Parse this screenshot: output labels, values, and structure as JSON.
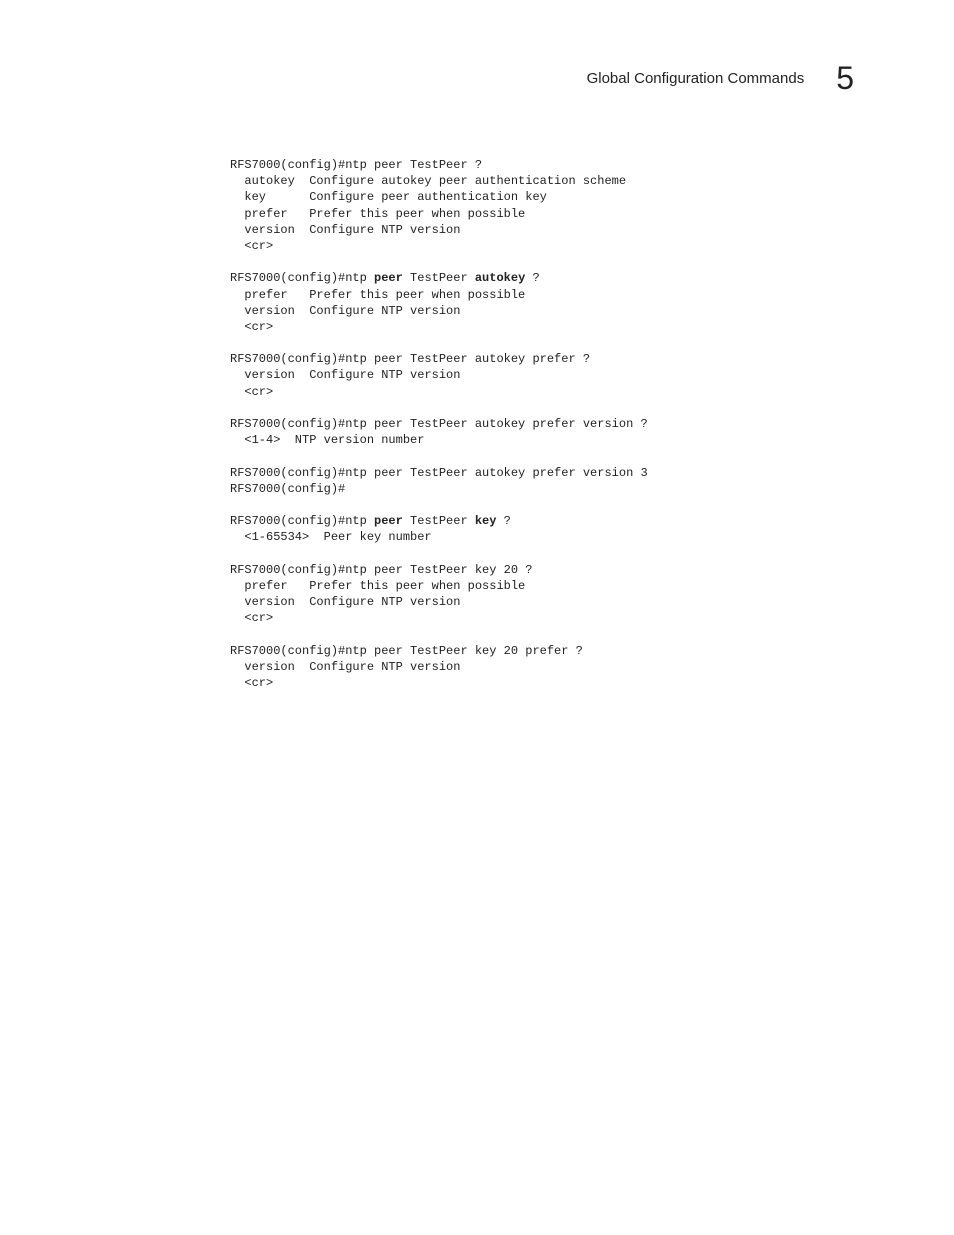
{
  "header": {
    "title": "Global Configuration Commands",
    "chapter": "5"
  },
  "code": {
    "l01a": "RFS7000(config)#ntp peer TestPeer ?",
    "l01b": "  autokey  Configure autokey peer authentication scheme",
    "l01c": "  key      Configure peer authentication key",
    "l01d": "  prefer   Prefer this peer when possible",
    "l01e": "  version  Configure NTP version",
    "l01f": "  <cr>",
    "l02a_pre": "RFS7000(config)#ntp ",
    "l02a_b1": "peer",
    "l02a_mid": " TestPeer ",
    "l02a_b2": "autokey",
    "l02a_post": " ?",
    "l02b": "  prefer   Prefer this peer when possible",
    "l02c": "  version  Configure NTP version",
    "l02d": "  <cr>",
    "l03a": "RFS7000(config)#ntp peer TestPeer autokey prefer ?",
    "l03b": "  version  Configure NTP version",
    "l03c": "  <cr>",
    "l04a": "RFS7000(config)#ntp peer TestPeer autokey prefer version ?",
    "l04b": "  <1-4>  NTP version number",
    "l05a": "RFS7000(config)#ntp peer TestPeer autokey prefer version 3",
    "l05b": "RFS7000(config)#",
    "l06a_pre": "RFS7000(config)#ntp ",
    "l06a_b1": "peer",
    "l06a_mid": " TestPeer ",
    "l06a_b2": "key",
    "l06a_post": " ?",
    "l06b": "  <1-65534>  Peer key number",
    "l07a": "RFS7000(config)#ntp peer TestPeer key 20 ?",
    "l07b": "  prefer   Prefer this peer when possible",
    "l07c": "  version  Configure NTP version",
    "l07d": "  <cr>",
    "l08a": "RFS7000(config)#ntp peer TestPeer key 20 prefer ?",
    "l08b": "  version  Configure NTP version",
    "l08c": "  <cr>"
  }
}
